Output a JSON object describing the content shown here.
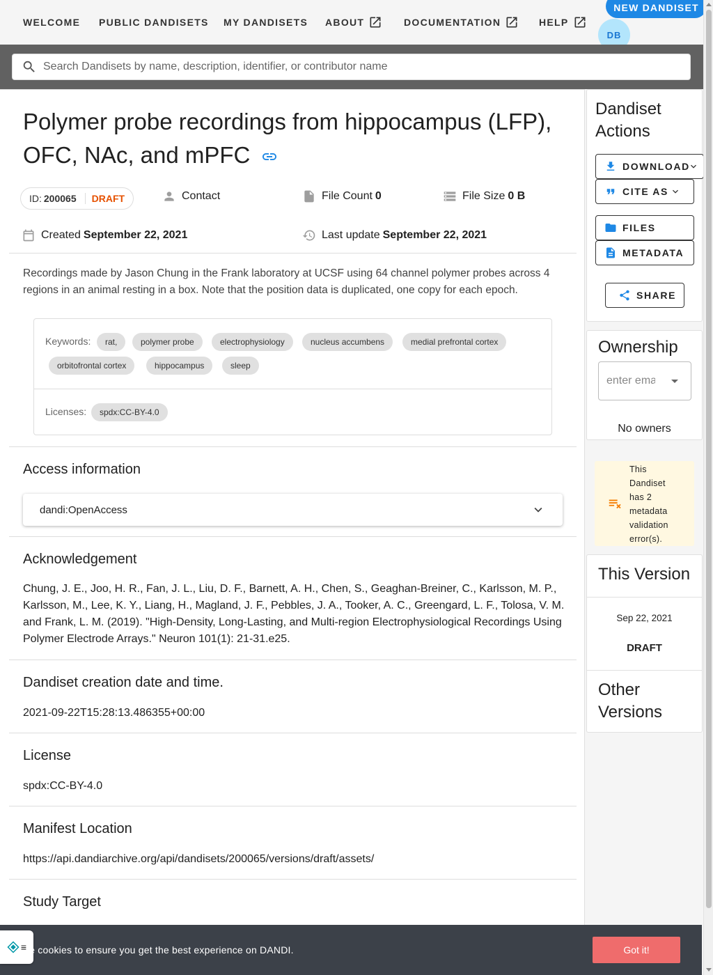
{
  "nav": {
    "welcome": "WELCOME",
    "public_dandisets": "PUBLIC DANDISETS",
    "my_dandisets": "MY DANDISETS",
    "about": "ABOUT",
    "documentation": "DOCUMENTATION",
    "help": "HELP",
    "new_dandiset": "NEW DANDISET",
    "avatar": "DB"
  },
  "search": {
    "placeholder": "Search Dandisets by name, description, identifier, or contributor name"
  },
  "dandiset": {
    "title": "Polymer probe recordings from hippocampus (LFP), OFC, NAc, and mPFC",
    "id_label": "ID:",
    "id": "200065",
    "status": "DRAFT",
    "contact": "Contact",
    "file_count_label": "File Count",
    "file_count": "0",
    "file_size_label": "File Size",
    "file_size": "0 B",
    "created_label": "Created",
    "created": "September 22, 2021",
    "updated_label": "Last update",
    "updated": "September 22, 2021",
    "description": "Recordings made by Jason Chung in the Frank laboratory at UCSF using 64 channel polymer probes across 4 regions in an animal resting in a box. Note that the position data is duplicated, one copy for each epoch.",
    "keywords_label": "Keywords:",
    "keywords": [
      "rat,",
      "polymer probe",
      "electrophysiology",
      "nucleus accumbens",
      "medial prefrontal cortex",
      "orbitofrontal cortex",
      "hippocampus",
      "sleep"
    ],
    "licenses_label": "Licenses:",
    "licenses": [
      "spdx:CC-BY-4.0"
    ]
  },
  "sections": {
    "access_title": "Access information",
    "access_value": "dandi:OpenAccess",
    "ack_title": "Acknowledgement",
    "ack_text": "Chung, J. E., Joo, H. R., Fan, J. L., Liu, D. F., Barnett, A. H., Chen, S., Geaghan-Breiner, C., Karlsson, M. P., Karlsson, M., Lee, K. Y., Liang, H., Magland, J. F., Pebbles, J. A., Tooker, A. C., Greengard, L. F., Tolosa, V. M. and Frank, L. M. (2019). \"High-Density, Long-Lasting, and Multi-region Electrophysiological Recordings Using Polymer Electrode Arrays.\" Neuron 101(1): 21-31.e25.",
    "created_title": "Dandiset creation date and time.",
    "created_value": "2021-09-22T15:28:13.486355+00:00",
    "license_title": "License",
    "license_value": "spdx:CC-BY-4.0",
    "manifest_title": "Manifest Location",
    "manifest_value": "https://api.dandiarchive.org/api/dandisets/200065/versions/draft/assets/",
    "study_title": "Study Target"
  },
  "actions": {
    "title": "Dandiset Actions",
    "download": "DOWNLOAD",
    "cite": "CITE AS",
    "files": "FILES",
    "metadata": "METADATA",
    "share": "SHARE"
  },
  "ownership": {
    "title": "Ownership",
    "placeholder": "enter email",
    "no_owners": "No owners"
  },
  "validation": {
    "message": "This Dandiset has 2 metadata validation error(s)."
  },
  "versions": {
    "this_title": "This Version",
    "date": "Sep 22, 2021",
    "label": "DRAFT",
    "other_title": "Other Versions"
  },
  "cookie": {
    "text": "se cookies to ensure you get the best experience on DANDI.",
    "button": "Got it!"
  },
  "colors": {
    "primary": "#1e88e5",
    "draft": "#e65100",
    "warning_bg": "#fff8e1",
    "warning_icon": "#f57c00",
    "cookie_bg": "#3c4149",
    "cookie_button": "#ef6c6c"
  },
  "icons": {
    "external": "open-in-new-icon",
    "search": "search-icon",
    "link": "link-icon",
    "contact": "person-icon",
    "file": "file-icon",
    "storage": "storage-icon",
    "calendar": "calendar-icon",
    "history": "history-icon"
  }
}
